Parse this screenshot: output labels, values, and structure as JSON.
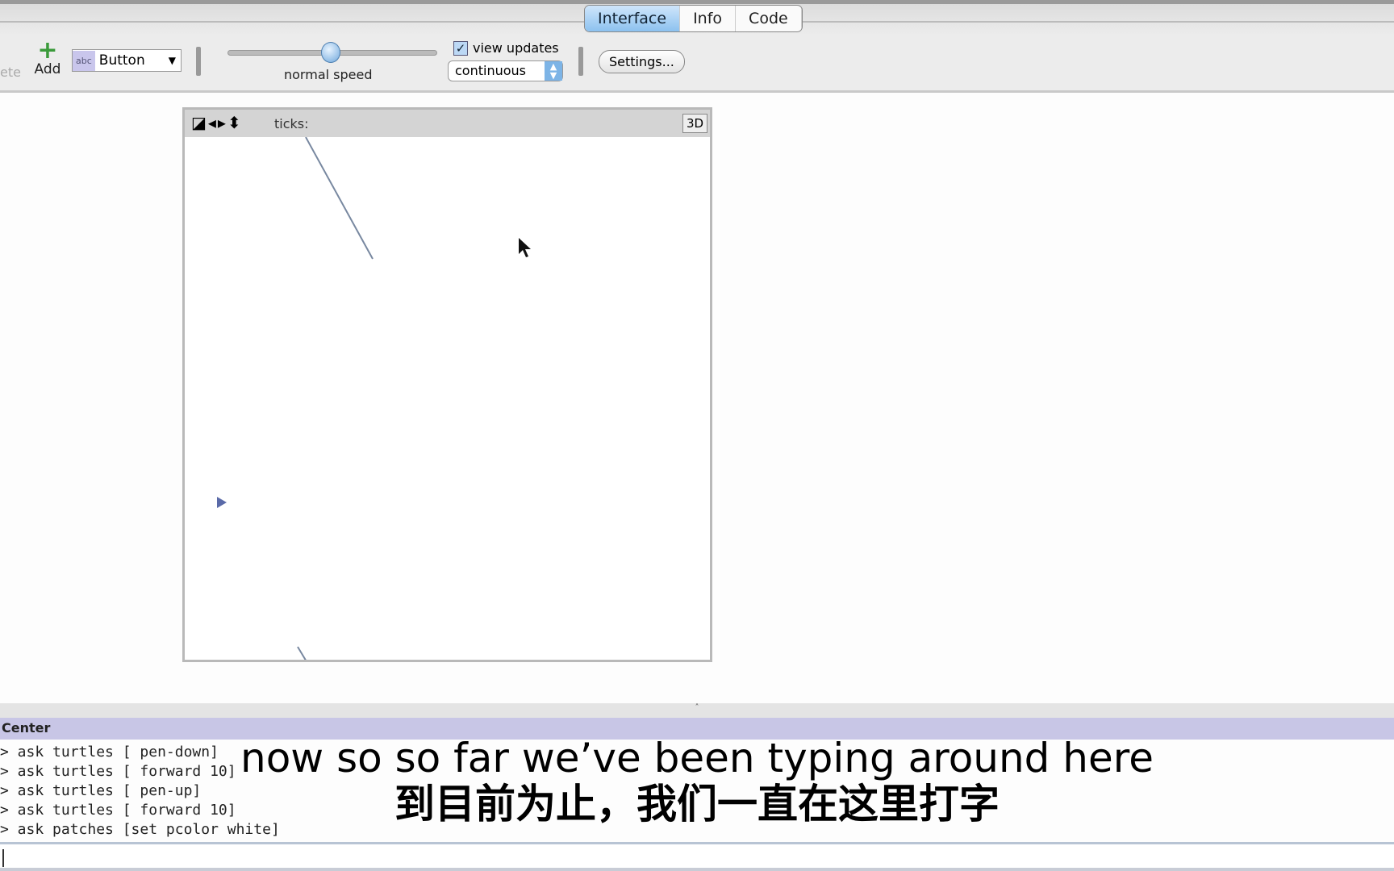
{
  "tabs": [
    {
      "label": "Interface",
      "active": true
    },
    {
      "label": "Info",
      "active": false
    },
    {
      "label": "Code",
      "active": false
    }
  ],
  "toolbar": {
    "delete_label": "ete",
    "add_label": "Add",
    "widget_select": "Button",
    "widget_icon_text": "abc",
    "speed_label": "normal speed",
    "speed_value_percent": 50,
    "view_updates_label": "view updates",
    "view_updates_checked": true,
    "update_mode": "continuous",
    "settings_label": "Settings..."
  },
  "view": {
    "ticks_label": "ticks:",
    "three_d_label": "3D"
  },
  "command_center": {
    "title": "Center",
    "history": [
      "> ask turtles [ pen-down]",
      "> ask turtles [ forward 10]",
      "> ask turtles [ pen-up]",
      "> ask turtles [ forward 10]",
      "> ask patches [set pcolor white]"
    ],
    "input_value": ""
  },
  "subtitles": {
    "english": "now so so far we’ve been typing around here",
    "chinese": "到目前为止，我们一直在这里打字"
  },
  "colors": {
    "active_tab": "#8cc1ef",
    "command_header": "#c8c6e6",
    "add_icon": "#3a9a3a",
    "turtle": "#5a6aa8"
  }
}
